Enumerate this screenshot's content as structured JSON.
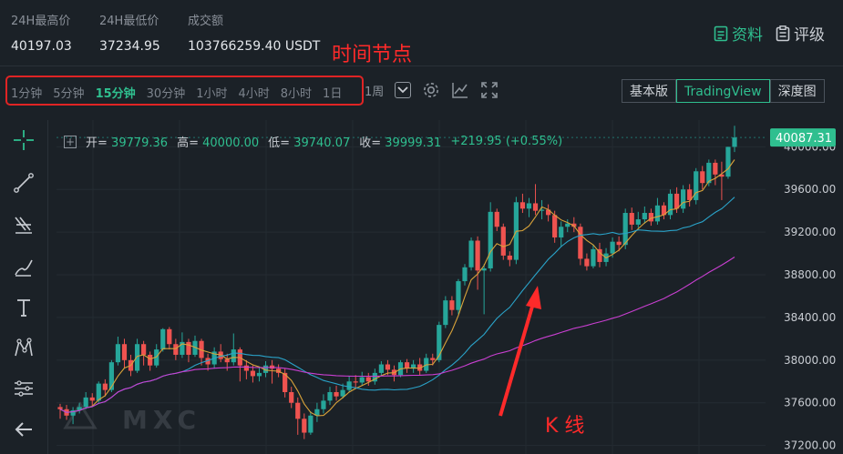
{
  "stats": {
    "high_label": "24H最高价",
    "high_value": "40197.03",
    "low_label": "24H最低价",
    "low_value": "37234.95",
    "vol_label": "成交额",
    "vol_value": "103766259.40 USDT"
  },
  "toplinks": {
    "info": "资料",
    "rating": "评级"
  },
  "annotations": {
    "time_nodes": "时间节点",
    "kline": "K 线"
  },
  "intervals": [
    "1分钟",
    "5分钟",
    "15分钟",
    "30分钟",
    "1小时",
    "4小时",
    "8小时",
    "1日"
  ],
  "active_interval": "15分钟",
  "extra_interval": "1周",
  "view_buttons": [
    "基本版",
    "TradingView",
    "深度图"
  ],
  "active_view": "TradingView",
  "ohlc": {
    "open_label": "开=",
    "open": "39779.36",
    "high_label": "高=",
    "high": "40000.00",
    "low_label": "低=",
    "low": "39740.07",
    "close_label": "收=",
    "close": "39999.31",
    "change": "+219.95 (+0.55%)"
  },
  "watermark": "MXC",
  "colors": {
    "up": "#26a69a",
    "down": "#ef5350",
    "accent": "#2fbf8f",
    "ma1": "#d9a33a",
    "ma2": "#2aa3c9",
    "ma3": "#c93fd1",
    "annotation": "#ff2a2a"
  },
  "chart_data": {
    "type": "candlestick",
    "y_ticks": [
      40000,
      39600,
      39200,
      38800,
      38400,
      38000,
      37600,
      37200
    ],
    "y_tick_labels": [
      "40000.00",
      "39600.00",
      "39200.00",
      "38800.00",
      "38400.00",
      "38000.00",
      "37600.00",
      "37200.00"
    ],
    "ylim": [
      37120,
      40250
    ],
    "last_price": "40087.31",
    "candles": [
      [
        37560,
        37540,
        37590,
        37450
      ],
      [
        37540,
        37480,
        37580,
        37440
      ],
      [
        37480,
        37530,
        37560,
        37400
      ],
      [
        37530,
        37560,
        37600,
        37500
      ],
      [
        37560,
        37650,
        37700,
        37540
      ],
      [
        37650,
        37620,
        37690,
        37560
      ],
      [
        37620,
        37780,
        37800,
        37600
      ],
      [
        37780,
        37720,
        37820,
        37660
      ],
      [
        37720,
        37980,
        38000,
        37700
      ],
      [
        37980,
        38150,
        38220,
        37950
      ],
      [
        38150,
        38000,
        38200,
        37930
      ],
      [
        38000,
        37900,
        38050,
        37850
      ],
      [
        37900,
        38150,
        38200,
        37880
      ],
      [
        38150,
        38050,
        38180,
        37950
      ],
      [
        38050,
        37950,
        38080,
        37900
      ],
      [
        37950,
        38100,
        38150,
        37930
      ],
      [
        38100,
        38290,
        38300,
        38080
      ],
      [
        38290,
        38150,
        38310,
        38100
      ],
      [
        38150,
        38050,
        38200,
        38000
      ],
      [
        38050,
        38170,
        38260,
        38020
      ],
      [
        38170,
        38050,
        38200,
        37980
      ],
      [
        38050,
        38180,
        38230,
        38030
      ],
      [
        38180,
        38020,
        38200,
        37950
      ],
      [
        38020,
        37960,
        38060,
        37900
      ],
      [
        37960,
        38080,
        38120,
        37920
      ],
      [
        38080,
        38010,
        38150,
        37980
      ],
      [
        38010,
        37980,
        38060,
        37900
      ],
      [
        37980,
        38100,
        38250,
        37950
      ],
      [
        38100,
        37950,
        38120,
        37800
      ],
      [
        37950,
        37900,
        38000,
        37820
      ],
      [
        37900,
        37850,
        37950,
        37790
      ],
      [
        37850,
        37880,
        37930,
        37800
      ],
      [
        37880,
        37950,
        37990,
        37840
      ],
      [
        37950,
        37920,
        38000,
        37780
      ],
      [
        37920,
        37880,
        37960,
        37840
      ],
      [
        37880,
        37700,
        37920,
        37650
      ],
      [
        37700,
        37600,
        37750,
        37550
      ],
      [
        37600,
        37450,
        37650,
        37300
      ],
      [
        37450,
        37320,
        37500,
        37260
      ],
      [
        37320,
        37480,
        37520,
        37300
      ],
      [
        37480,
        37540,
        37600,
        37420
      ],
      [
        37540,
        37620,
        37680,
        37500
      ],
      [
        37620,
        37700,
        37750,
        37580
      ],
      [
        37700,
        37660,
        37760,
        37620
      ],
      [
        37660,
        37720,
        37780,
        37640
      ],
      [
        37720,
        37800,
        37850,
        37700
      ],
      [
        37800,
        37790,
        37860,
        37740
      ],
      [
        37790,
        37840,
        37890,
        37760
      ],
      [
        37840,
        37800,
        37880,
        37760
      ],
      [
        37800,
        37880,
        37920,
        37770
      ],
      [
        37880,
        37960,
        37990,
        37850
      ],
      [
        37960,
        37910,
        38000,
        37860
      ],
      [
        37910,
        37860,
        37950,
        37800
      ],
      [
        37860,
        37980,
        38000,
        37840
      ],
      [
        37980,
        37920,
        38010,
        37880
      ],
      [
        37920,
        37960,
        38000,
        37880
      ],
      [
        37960,
        37900,
        38020,
        37860
      ],
      [
        37900,
        38020,
        38060,
        37880
      ],
      [
        38020,
        38000,
        38060,
        37950
      ],
      [
        38000,
        38330,
        38360,
        37980
      ],
      [
        38330,
        38560,
        38600,
        38300
      ],
      [
        38560,
        38470,
        38600,
        38420
      ],
      [
        38470,
        38740,
        38760,
        38430
      ],
      [
        38740,
        38870,
        38900,
        38700
      ],
      [
        38870,
        39120,
        39150,
        38840
      ],
      [
        39120,
        38840,
        39160,
        38660
      ],
      [
        38840,
        38860,
        38900,
        38430
      ],
      [
        38860,
        39390,
        39480,
        38830
      ],
      [
        39390,
        39250,
        39420,
        39210
      ],
      [
        39250,
        38980,
        39280,
        38940
      ],
      [
        38980,
        38940,
        39020,
        38880
      ],
      [
        38940,
        39480,
        39530,
        38900
      ],
      [
        39480,
        39420,
        39560,
        39380
      ],
      [
        39420,
        39470,
        39520,
        39340
      ],
      [
        39470,
        39400,
        39650,
        39360
      ],
      [
        39400,
        39410,
        39500,
        39320
      ],
      [
        39410,
        39360,
        39460,
        39300
      ],
      [
        39360,
        39150,
        39400,
        39100
      ],
      [
        39150,
        39250,
        39300,
        39060
      ],
      [
        39250,
        39280,
        39320,
        39200
      ],
      [
        39280,
        39250,
        39340,
        39200
      ],
      [
        39250,
        38950,
        39280,
        38890
      ],
      [
        38950,
        38880,
        39000,
        38840
      ],
      [
        38880,
        39040,
        39080,
        38860
      ],
      [
        39040,
        38920,
        39100,
        38870
      ],
      [
        38920,
        39000,
        39050,
        38880
      ],
      [
        39000,
        39110,
        39150,
        38960
      ],
      [
        39110,
        39080,
        39160,
        39020
      ],
      [
        39080,
        39380,
        39420,
        39040
      ],
      [
        39380,
        39270,
        39430,
        39220
      ],
      [
        39270,
        39320,
        39390,
        39240
      ],
      [
        39320,
        39380,
        39440,
        39280
      ],
      [
        39380,
        39300,
        39420,
        39260
      ],
      [
        39300,
        39450,
        39520,
        39270
      ],
      [
        39450,
        39360,
        39480,
        39320
      ],
      [
        39360,
        39560,
        39600,
        39320
      ],
      [
        39560,
        39420,
        39620,
        39380
      ],
      [
        39420,
        39600,
        39640,
        39380
      ],
      [
        39600,
        39500,
        39650,
        39440
      ],
      [
        39500,
        39770,
        39800,
        39460
      ],
      [
        39770,
        39660,
        39820,
        39600
      ],
      [
        39660,
        39850,
        39880,
        39630
      ],
      [
        39850,
        39740,
        39880,
        39640
      ],
      [
        39740,
        39720,
        39860,
        39500
      ],
      [
        39720,
        39999,
        40000,
        39700
      ],
      [
        39999,
        40087,
        40197,
        39950
      ]
    ]
  }
}
